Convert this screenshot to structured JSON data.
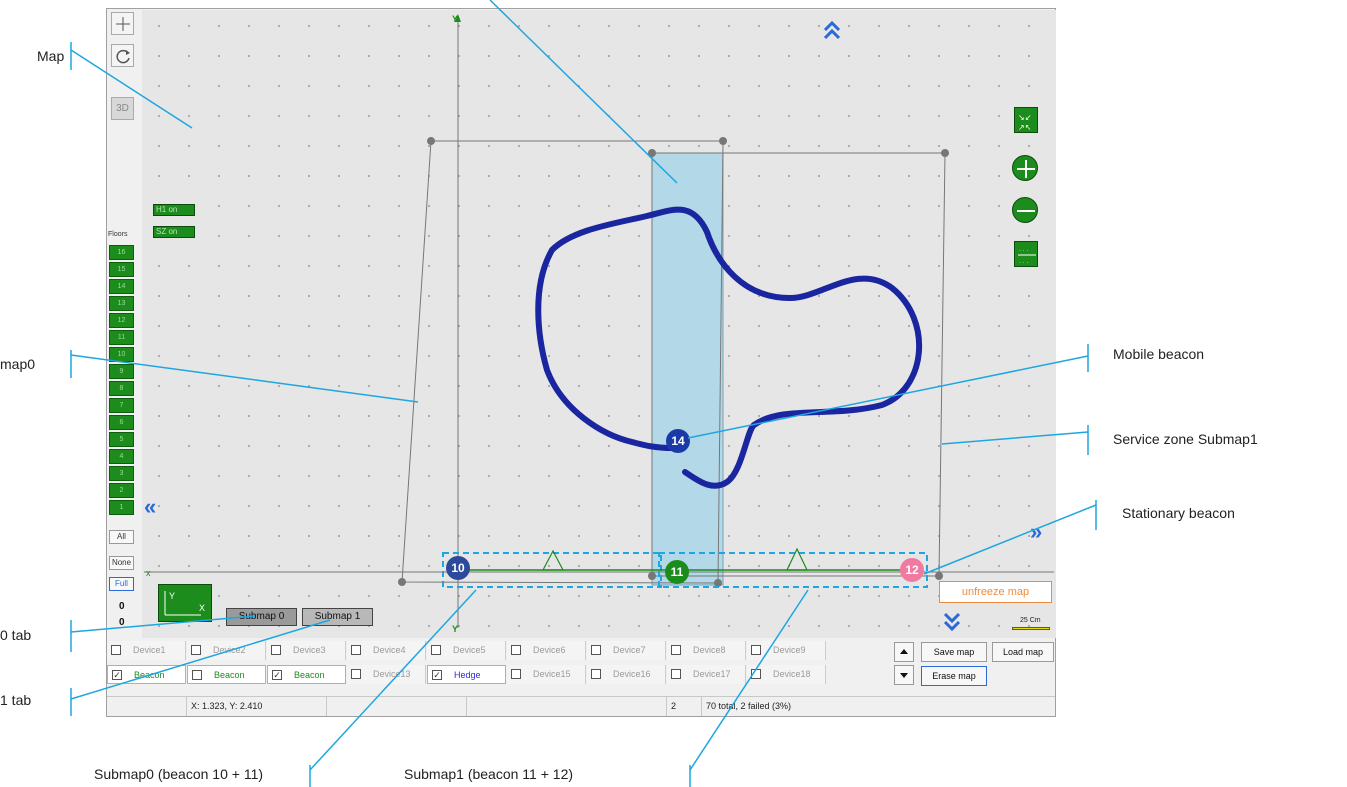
{
  "annotations": {
    "map": "Map",
    "submap0": "map0",
    "submap0_tab": "0 tab",
    "submap1_tab": "1 tab",
    "mobile_beacon": "Mobile beacon",
    "service_zone": "Service zone Submap1",
    "stationary_beacon": "Stationary beacon",
    "submap0_pair": "Submap0 (beacon 10 + 11)",
    "submap1_pair": "Submap1 (beacon 11 + 12)"
  },
  "toolbar": {
    "three_d_label": "3D"
  },
  "floors": {
    "label": "Floors",
    "levels": [
      "16",
      "15",
      "14",
      "13",
      "12",
      "11",
      "10",
      "9",
      "8",
      "7",
      "6",
      "5",
      "4",
      "3",
      "2",
      "1"
    ],
    "all_label": "All",
    "none_label": "None",
    "full_label": "Full",
    "value_top": "0",
    "value_bottom": "0"
  },
  "map": {
    "tags": {
      "h1": "H1 on",
      "sz": "SZ on"
    },
    "axis": {
      "y_top": "Y",
      "y_bottom": "Y",
      "x_left": "X",
      "x_right": "X"
    },
    "beacons": [
      {
        "id": "10",
        "color": "#2c4a9a",
        "kind": "stationary"
      },
      {
        "id": "11",
        "color": "#1c8c1c",
        "kind": "stationary"
      },
      {
        "id": "12",
        "color": "#f07aa0",
        "kind": "stationary"
      },
      {
        "id": "14",
        "color": "#1a3aa8",
        "kind": "mobile"
      }
    ],
    "unfreeze_label": "unfreeze map",
    "scale_label": "25 Cm",
    "path_color": "#1a25a0",
    "service_zone_color": "#b3d9e8"
  },
  "tabs": {
    "submap0": "Submap 0",
    "submap1": "Submap 1"
  },
  "devices_row1": [
    {
      "label": "Device1",
      "checked": false,
      "style": ""
    },
    {
      "label": "Device2",
      "checked": false,
      "style": ""
    },
    {
      "label": "Device3",
      "checked": false,
      "style": ""
    },
    {
      "label": "Device4",
      "checked": false,
      "style": ""
    },
    {
      "label": "Device5",
      "checked": false,
      "style": ""
    },
    {
      "label": "Device6",
      "checked": false,
      "style": ""
    },
    {
      "label": "Device7",
      "checked": false,
      "style": ""
    },
    {
      "label": "Device8",
      "checked": false,
      "style": ""
    },
    {
      "label": "Device9",
      "checked": false,
      "style": ""
    }
  ],
  "devices_row2": [
    {
      "label": "Beacon",
      "checked": true,
      "style": "beacon"
    },
    {
      "label": "Beacon",
      "checked": false,
      "style": "beacon"
    },
    {
      "label": "Beacon",
      "checked": true,
      "style": "beacon"
    },
    {
      "label": "Device13",
      "checked": false,
      "style": ""
    },
    {
      "label": "Hedge",
      "checked": true,
      "style": "hedge"
    },
    {
      "label": "Device15",
      "checked": false,
      "style": ""
    },
    {
      "label": "Device16",
      "checked": false,
      "style": ""
    },
    {
      "label": "Device17",
      "checked": false,
      "style": ""
    },
    {
      "label": "Device18",
      "checked": false,
      "style": ""
    }
  ],
  "buttons": {
    "save_map": "Save map",
    "load_map": "Load map",
    "erase_map": "Erase map"
  },
  "status": {
    "coords": "X: 1.323, Y: 2.410",
    "count": "2",
    "summary": "70 total, 2 failed (3%)"
  }
}
